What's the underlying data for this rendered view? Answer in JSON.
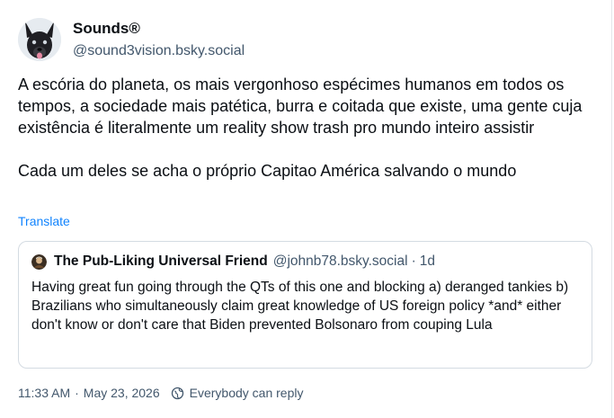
{
  "author": {
    "display_name": "Sounds®",
    "handle": "@sound3vision.bsky.social",
    "avatar_icon": "dog-avatar"
  },
  "post": {
    "text": "A escória do planeta, os mais vergonhoso espécimes humanos em todos os tempos, a sociedade mais patética, burra e coitada que existe, uma gente cuja existência é literalmente um reality show trash pro mundo inteiro assistir\n\nCada um deles se acha o próprio Capitao América salvando o mundo",
    "translate_label": "Translate"
  },
  "quote": {
    "display_name": "The Pub-Liking Universal Friend",
    "handle": "@johnb78.bsky.social",
    "separator": "·",
    "time": "1d",
    "text": "Having great fun going through the QTs of this one and blocking a) deranged tankies b) Brazilians who simultaneously claim great knowledge of US foreign policy *and* either don't know or don't care that Biden prevented Bolsonaro from couping Lula"
  },
  "footer": {
    "timestamp": "11:33 AM",
    "separator": "·",
    "date": "May 23, 2026",
    "reply_setting": "Everybody can reply",
    "reply_icon": "globe-icon"
  },
  "colors": {
    "text": "#0b0f14",
    "muted": "#42576c",
    "link": "#1083fe",
    "border": "#d4dbe2"
  }
}
